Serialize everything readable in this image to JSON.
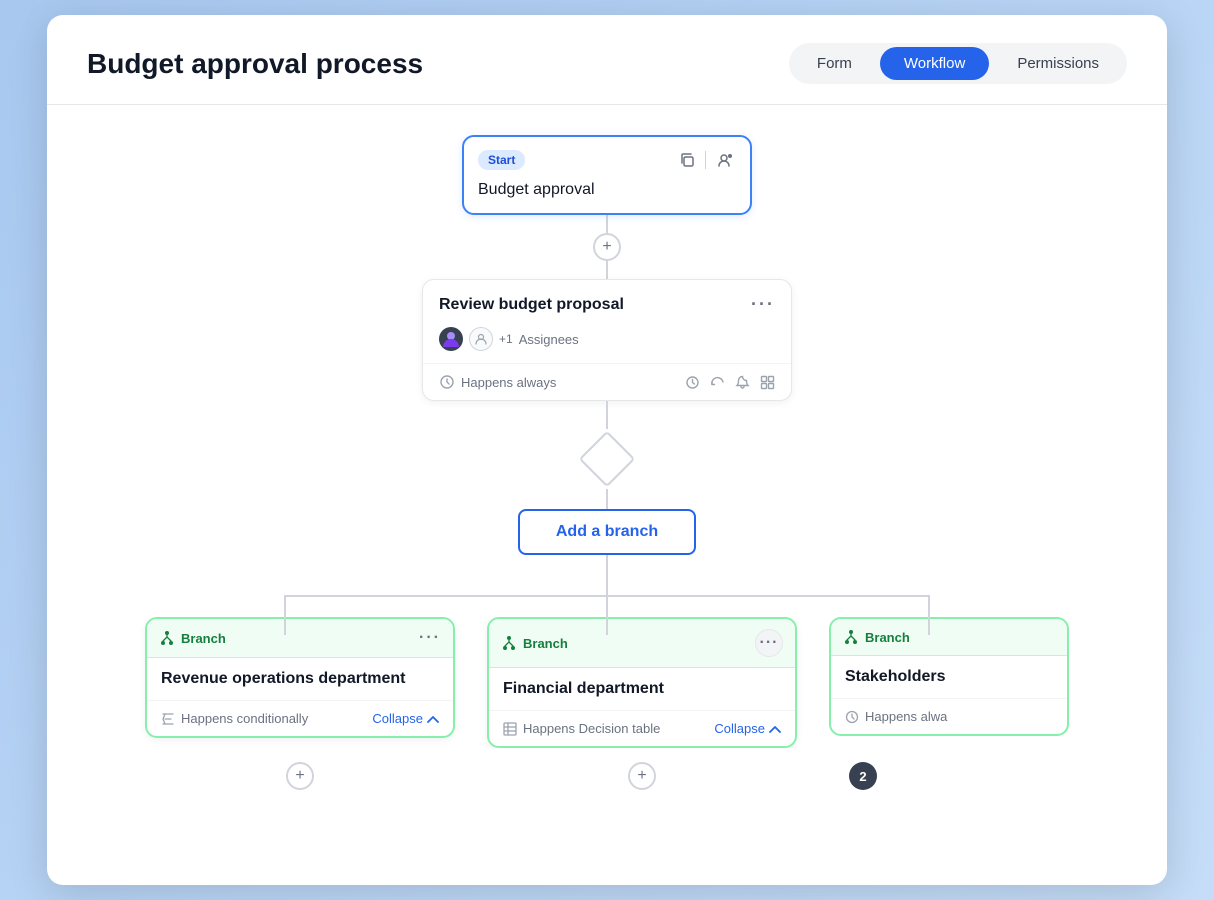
{
  "page": {
    "title": "Budget approval process"
  },
  "tabs": {
    "form": "Form",
    "workflow": "Workflow",
    "permissions": "Permissions",
    "active": "workflow"
  },
  "start_node": {
    "badge": "Start",
    "title": "Budget approval"
  },
  "add_connector": "+",
  "task_node": {
    "title": "Review budget proposal",
    "assignees_label": "Assignees",
    "count": "+1",
    "happens_label": "Happens always"
  },
  "add_branch_btn": "Add a branch",
  "branches": [
    {
      "id": "branch-1",
      "label": "Branch",
      "title": "Revenue operations department",
      "happens_type": "conditionally",
      "happens_label": "Happens conditionally",
      "collapse_label": "Collapse"
    },
    {
      "id": "branch-2",
      "label": "Branch",
      "title": "Financial department",
      "happens_type": "decision-table",
      "happens_label": "Happens Decision table",
      "collapse_label": "Collapse"
    },
    {
      "id": "branch-3",
      "label": "Branch",
      "title": "Stakeholders",
      "happens_type": "always",
      "happens_label": "Happens alwa",
      "collapse_label": ""
    }
  ],
  "icons": {
    "copy": "⧉",
    "user_settings": "👤",
    "more": "•••",
    "clock": "🕐",
    "refresh": "↺",
    "bell": "🔔",
    "grid": "⊞",
    "formula": "ƒ",
    "table": "⊟",
    "branch_symbol": "⑂",
    "chevron_up": "∧",
    "plus": "+"
  }
}
